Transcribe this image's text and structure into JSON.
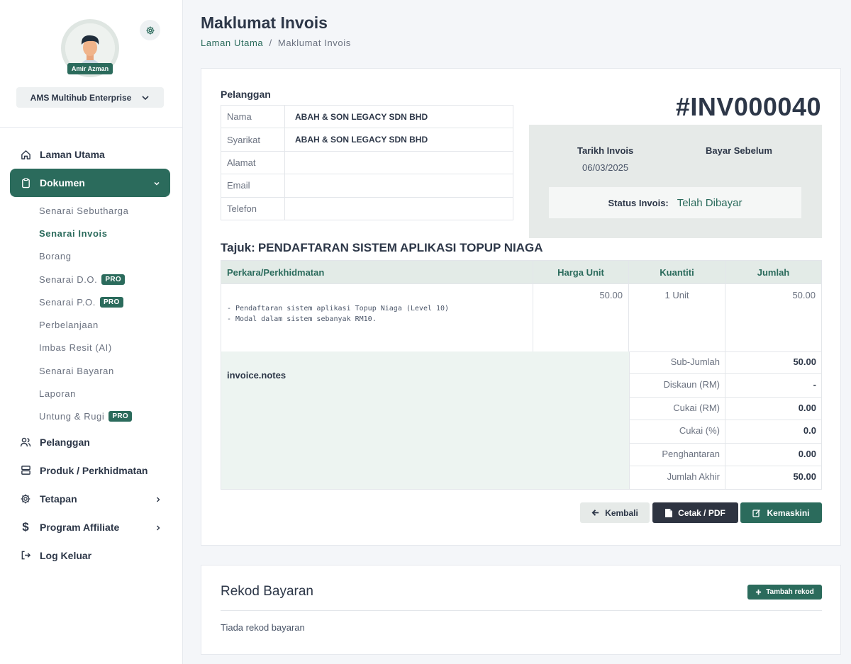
{
  "sidebar": {
    "user_name": "Amir Azman",
    "company": "AMS Multihub Enterprise",
    "nav": {
      "home": "Laman Utama",
      "dokumen": "Dokumen",
      "sub": {
        "sebutharga": "Senarai Sebutharga",
        "invois": "Senarai Invois",
        "borang": "Borang",
        "do": "Senarai D.O.",
        "po": "Senarai P.O.",
        "perbelanjaan": "Perbelanjaan",
        "imbas": "Imbas Resit (AI)",
        "bayaran": "Senarai Bayaran",
        "laporan": "Laporan",
        "untung": "Untung & Rugi"
      },
      "pro": "PRO",
      "pelanggan": "Pelanggan",
      "produk": "Produk / Perkhidmatan",
      "tetapan": "Tetapan",
      "affiliate": "Program Affiliate",
      "logout": "Log Keluar"
    }
  },
  "header": {
    "title": "Maklumat Invois",
    "breadcrumb_home": "Laman Utama",
    "breadcrumb_sep": "/",
    "breadcrumb_current": "Maklumat Invois"
  },
  "customer": {
    "section_label": "Pelanggan",
    "rows": [
      {
        "key": "Nama",
        "value": "ABAH & SON LEGACY SDN BHD"
      },
      {
        "key": "Syarikat",
        "value": "ABAH & SON LEGACY SDN BHD"
      },
      {
        "key": "Alamat",
        "value": ""
      },
      {
        "key": "Email",
        "value": ""
      },
      {
        "key": "Telefon",
        "value": ""
      }
    ]
  },
  "invoice": {
    "number": "#INV000040",
    "date_label": "Tarikh Invois",
    "date_value": "06/03/2025",
    "due_label": "Bayar Sebelum",
    "status_label": "Status Invois:",
    "status_value": "Telah Dibayar",
    "tajuk_label": "Tajuk:",
    "tajuk_value": "PENDAFTARAN SISTEM APLIKASI TOPUP NIAGA"
  },
  "items": {
    "headers": [
      "Perkara/Perkhidmatan",
      "Harga Unit",
      "Kuantiti",
      "Jumlah"
    ],
    "rows": [
      {
        "desc_line1": "- Pendaftaran sistem aplikasi Topup Niaga (Level 10)",
        "desc_line2": "- Modal dalam sistem sebanyak RM10.",
        "unit_price": "50.00",
        "qty": "1 Unit",
        "total": "50.00"
      }
    ]
  },
  "totals": {
    "notes": "invoice.notes",
    "rows": [
      {
        "label": "Sub-Jumlah",
        "value": "50.00"
      },
      {
        "label": "Diskaun (RM)",
        "value": "-"
      },
      {
        "label": "Cukai (RM)",
        "value": "0.00"
      },
      {
        "label": "Cukai (%)",
        "value": "0.0"
      },
      {
        "label": "Penghantaran",
        "value": "0.00"
      },
      {
        "label": "Jumlah Akhir",
        "value": "50.00"
      }
    ]
  },
  "actions": {
    "back": "Kembali",
    "print": "Cetak / PDF",
    "edit": "Kemaskini"
  },
  "payments": {
    "title": "Rekod Bayaran",
    "add": "Tambah rekod",
    "empty": "Tiada rekod bayaran"
  },
  "colors": {
    "accent": "#2b6b5c",
    "dark_button": "#2e3441"
  }
}
